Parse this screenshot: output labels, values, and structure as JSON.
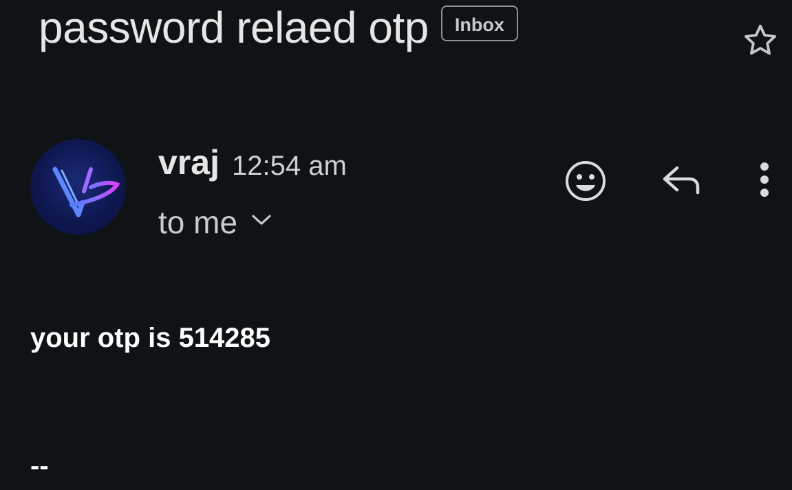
{
  "email": {
    "subject": "password relaed otp",
    "label": "Inbox",
    "sender": {
      "name": "vraj",
      "time": "12:54 am",
      "recipients": "to me"
    },
    "body": "your otp is 514285",
    "signature_separator": "--"
  },
  "icons": {
    "star": "star-icon",
    "avatar": "vraj-logo-avatar",
    "recipients_toggle": "chevron-down-icon",
    "react": "emoji-icon",
    "reply": "reply-icon",
    "more": "more-vert-icon"
  },
  "colors": {
    "background": "#0f1316",
    "text_primary": "#e6e6e6",
    "chip_border": "#8e9196",
    "avatar_bg": "#0e1850",
    "logo_blue": "#4f7bff",
    "logo_magenta": "#e040fb"
  }
}
